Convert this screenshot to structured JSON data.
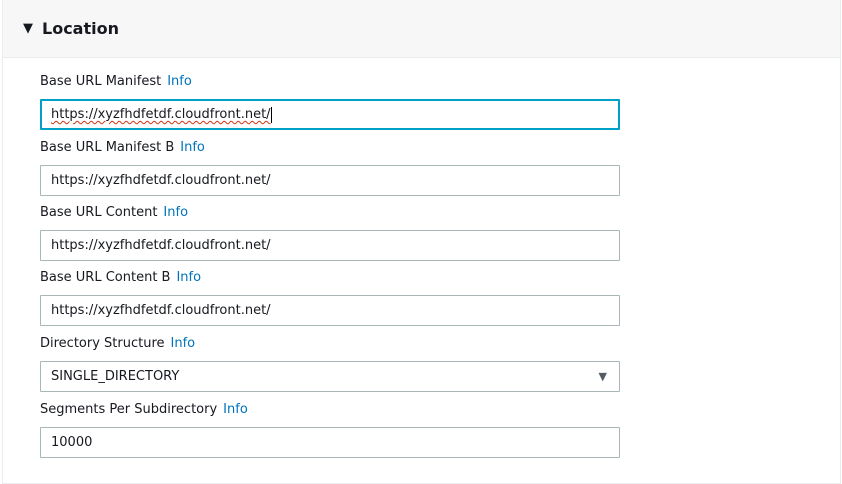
{
  "section": {
    "title": "Location",
    "caret_icon": "caret-down-icon"
  },
  "info_label": "Info",
  "fields": [
    {
      "label": "Base URL Manifest",
      "value": "https://xyzfhdfetdf.cloudfront.net/"
    },
    {
      "label": "Base URL Manifest B",
      "value": "https://xyzfhdfetdf.cloudfront.net/"
    },
    {
      "label": "Base URL Content",
      "value": "https://xyzfhdfetdf.cloudfront.net/"
    },
    {
      "label": "Base URL Content B",
      "value": "https://xyzfhdfetdf.cloudfront.net/"
    },
    {
      "label": "Directory Structure",
      "value": "SINGLE_DIRECTORY"
    },
    {
      "label": "Segments Per Subdirectory",
      "value": "10000"
    }
  ]
}
